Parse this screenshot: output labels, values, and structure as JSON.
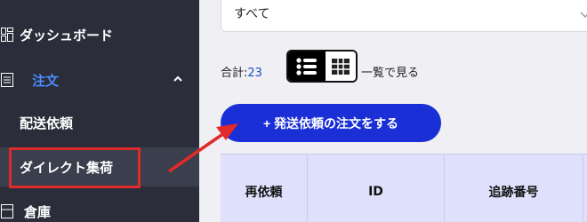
{
  "sidebar": {
    "items": [
      {
        "label": "ダッシュボード",
        "icon": "dashboard-icon"
      },
      {
        "label": "注文",
        "icon": "orders-icon"
      },
      {
        "label": "配送依頼"
      },
      {
        "label": "ダイレクト集荷"
      },
      {
        "label": "倉庫",
        "icon": "warehouse-icon"
      }
    ]
  },
  "filter": {
    "value": "すべて"
  },
  "summary": {
    "total_label": "合計:",
    "total_count": "23",
    "view_text": "一覧で見る"
  },
  "actions": {
    "add_request_label": "+ 発送依頼の注文をする"
  },
  "table": {
    "headers": [
      "再依頼",
      "ID",
      "追跡番号"
    ]
  },
  "colors": {
    "accent": "#1a2fd6",
    "highlight": "#e12a2a",
    "sidebar_bg": "#2b2e3a",
    "active_link": "#4d8cff"
  }
}
